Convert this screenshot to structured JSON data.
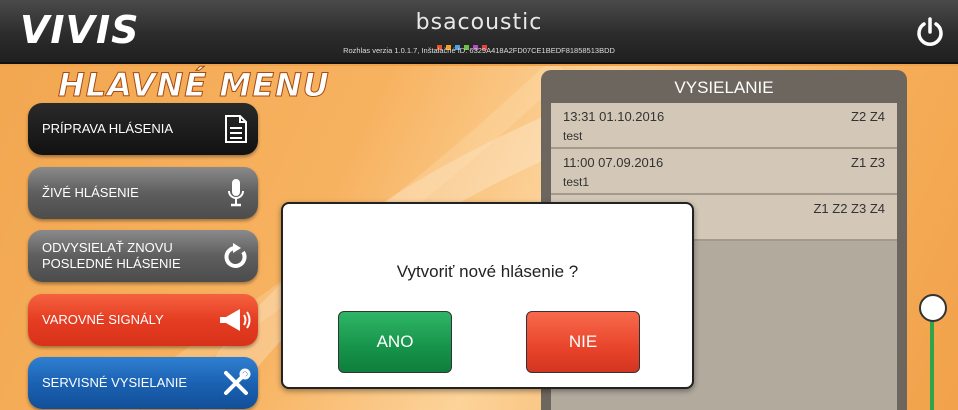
{
  "header": {
    "logo": "VIVIS",
    "brand": "bsacoustic",
    "version_text": "Rozhlas verzia 1.0.1.7, Inštalačné ID: 6329A418A2FD07CE1BEDF81858513BDD",
    "brand_dot_colors": [
      "#e6532a",
      "#f2a21b",
      "#4aa3df",
      "#6cc04a",
      "#b14ec0",
      "#e0443a"
    ]
  },
  "menu": {
    "title": "HLAVNÉ MENU",
    "items": [
      {
        "label": "PRÍPRAVA HLÁSENIA",
        "icon": "document-icon"
      },
      {
        "label": "ŽIVÉ HLÁSENIE",
        "icon": "microphone-icon"
      },
      {
        "label": "ODVYSIELAŤ ZNOVU POSLEDNÉ HLÁSENIE",
        "icon": "refresh-icon"
      },
      {
        "label": "VAROVNÉ SIGNÁLY",
        "icon": "megaphone-icon"
      },
      {
        "label": "SERVISNÉ VYSIELANIE",
        "icon": "tools-icon"
      }
    ]
  },
  "broadcast": {
    "title": "VYSIELANIE",
    "items": [
      {
        "datetime": "13:31 01.10.2016",
        "zones": "Z2 Z4",
        "name": "test"
      },
      {
        "datetime": "11:00 07.09.2016",
        "zones": "Z1 Z3",
        "name": "test1"
      },
      {
        "datetime": "",
        "zones": "Z1 Z2 Z3 Z4",
        "name": ""
      }
    ]
  },
  "dialog": {
    "question": "Vytvoriť nové hlásenie ?",
    "yes_label": "ANO",
    "no_label": "NIE"
  },
  "volume_slider": {
    "level": 0.85
  },
  "colors": {
    "accent_green": "#16934a",
    "accent_red": "#e8442b",
    "accent_blue": "#1b62b3",
    "background_orange": "#f2a750"
  }
}
